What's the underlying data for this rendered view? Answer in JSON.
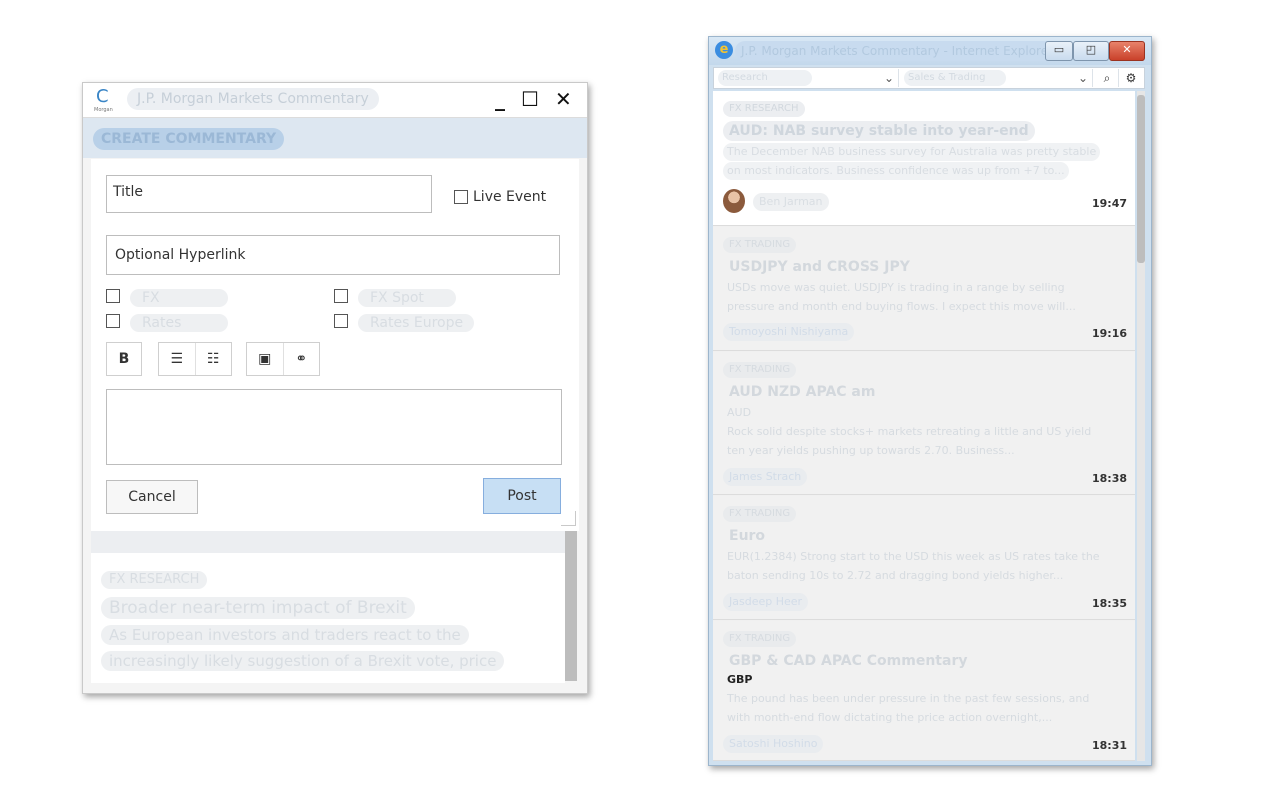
{
  "left_window": {
    "title": "J.P. Morgan Markets Commentary",
    "logo_text": "Morgan",
    "controls": {
      "minimize": "_",
      "maximize": "☐",
      "close": "✕"
    },
    "section_header": "CREATE COMMENTARY",
    "form": {
      "title_placeholder": "Title",
      "live_event_label": "Live Event",
      "hyperlink_placeholder": "Optional Hyperlink",
      "categories": [
        "FX",
        "Rates",
        "FX Spot",
        "Rates Europe"
      ],
      "toolbar": {
        "bold": "B",
        "bullet_list": "☰",
        "numbered_list": "☷",
        "image": "▣",
        "link": "⚭"
      },
      "cancel_label": "Cancel",
      "post_label": "Post"
    },
    "behind_item": {
      "category": "FX RESEARCH",
      "title": "Broader near-term impact of Brexit",
      "line1": "As European investors and traders react to the",
      "line2": "increasingly likely suggestion of a Brexit vote, price"
    }
  },
  "right_window": {
    "title": "J.P. Morgan Markets Commentary - Internet Explorer",
    "controls": {
      "minimize": "▭",
      "restore": "◰",
      "close": "✕"
    },
    "filters": {
      "research": "Research",
      "sales_trading": "Sales & Trading",
      "search_icon": "⌕",
      "settings_icon": "⚙"
    },
    "items": [
      {
        "category": "FX RESEARCH",
        "title": "AUD: NAB survey stable into year-end",
        "line1": "The December NAB business survey for Australia was pretty stable",
        "line2": "on most indicators. Business confidence was up from +7 to...",
        "author": "Ben Jarman",
        "time": "19:47"
      },
      {
        "category": "FX TRADING",
        "title": "USDJPY and CROSS JPY",
        "line1": "USDs move was quiet. USDJPY is trading in a range by selling",
        "line2": "pressure and month end buying flows. I expect this move will...",
        "author": "Tomoyoshi Nishiyama",
        "time": "19:16"
      },
      {
        "category": "FX TRADING",
        "title": "AUD NZD APAC am",
        "subtitle": "AUD",
        "line1": "Rock solid despite stocks+ markets retreating a little and US yield",
        "line2": "ten year yields pushing up towards 2.70. Business...",
        "author": "James Strach",
        "time": "18:38"
      },
      {
        "category": "FX TRADING",
        "title": "Euro",
        "line1": "EUR(1.2384) Strong start to the USD this week as US rates take the",
        "line2": "baton sending 10s to 2.72 and dragging bond yields higher...",
        "author": "Jasdeep Heer",
        "time": "18:35"
      },
      {
        "category": "FX TRADING",
        "title": "GBP & CAD APAC Commentary",
        "subtitle": "GBP",
        "line1": "The pound has been under pressure in the past few sessions, and",
        "line2": "with month-end flow dictating the price action overnight,...",
        "author": "Satoshi Hoshino",
        "time": "18:31"
      }
    ]
  },
  "colors": {
    "post_button": "#c7dff4",
    "section_header_bg": "#dde7f1",
    "ie_close": "#c9412a"
  }
}
